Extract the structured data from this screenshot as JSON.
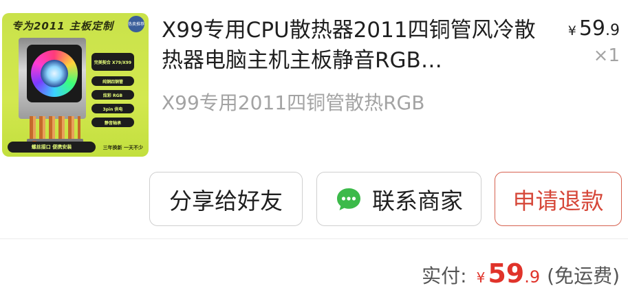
{
  "product": {
    "thumbnail": {
      "banner": "专为2011 主板定制",
      "badge": "热卖推荐",
      "features": [
        "完美契合 X79/X99",
        "纯铜四铜管",
        "炫彩 RGB",
        "3pin 供电",
        "静音轴承"
      ],
      "footer": "螺丝接口 便携安装",
      "corner": "三年换新 一天不少"
    },
    "title": "X99专用CPU散热器2011四铜管风冷散热器电脑主机主板静音RGB…",
    "spec": "X99专用2011四铜管散热RGB",
    "price": {
      "currency": "¥",
      "integer": "59",
      "decimal": ".9"
    },
    "quantity": "×1"
  },
  "actions": {
    "share": "分享给好友",
    "contact": "联系商家",
    "refund": "申请退款"
  },
  "payment": {
    "label": "实付:",
    "currency": "¥",
    "integer": "59",
    "decimal": ".9",
    "note": "(免运费)"
  },
  "colors": {
    "accent": "#e0332a",
    "refund_border": "#d6604e",
    "chat_icon": "#3cba4a"
  },
  "icons": {
    "contact": "chat-bubble-icon"
  }
}
